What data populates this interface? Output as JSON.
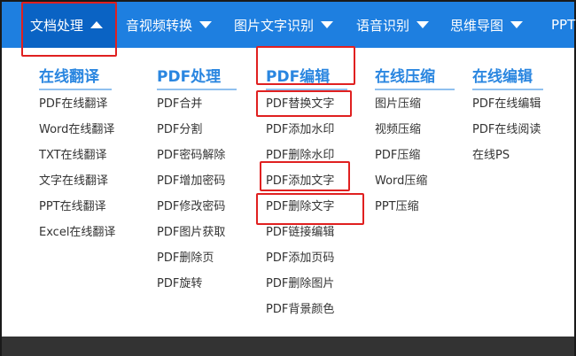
{
  "nav": {
    "items": [
      {
        "label": "文档处理"
      },
      {
        "label": "音视频转换"
      },
      {
        "label": "图片文字识别"
      },
      {
        "label": "语音识别"
      },
      {
        "label": "思维导图"
      },
      {
        "label": "PPT"
      }
    ]
  },
  "menu": {
    "columns": [
      {
        "title": "在线翻译",
        "items": [
          "PDF在线翻译",
          "Word在线翻译",
          "TXT在线翻译",
          "文字在线翻译",
          "PPT在线翻译",
          "Excel在线翻译"
        ]
      },
      {
        "title": "PDF处理",
        "items": [
          "PDF合并",
          "PDF分割",
          "PDF密码解除",
          "PDF增加密码",
          "PDF修改密码",
          "PDF图片获取",
          "PDF删除页",
          "PDF旋转"
        ]
      },
      {
        "title": "PDF编辑",
        "items": [
          "PDF替换文字",
          "PDF添加水印",
          "PDF删除水印",
          "PDF添加文字",
          "PDF删除文字",
          "PDF链接编辑",
          "PDF添加页码",
          "PDF删除图片",
          "PDF背景颜色"
        ]
      },
      {
        "title": "在线压缩",
        "items": [
          "图片压缩",
          "视频压缩",
          "PDF压缩",
          "Word压缩",
          "PPT压缩"
        ]
      },
      {
        "title": "在线编辑",
        "items": [
          "PDF在线编辑",
          "PDF在线阅读",
          "在线PS"
        ]
      }
    ]
  },
  "colors": {
    "nav_bg": "#1e7fe0",
    "nav_active": "#0a63c4",
    "header_text": "#2a86e0",
    "highlight": "#e02020"
  }
}
